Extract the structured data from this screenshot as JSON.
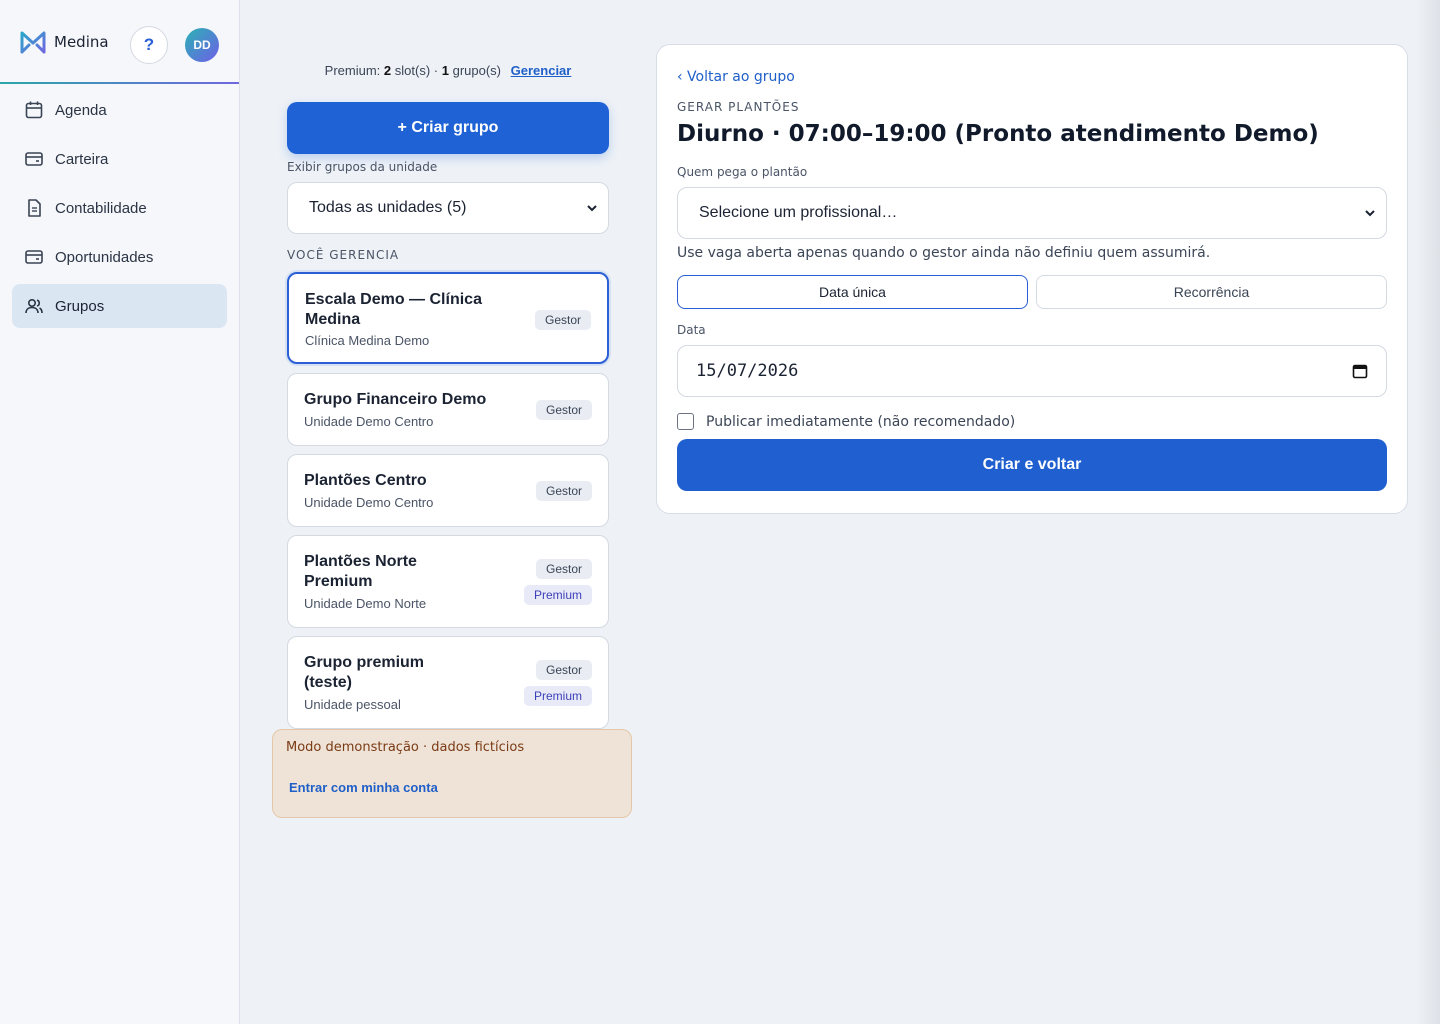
{
  "app": {
    "brand": "Medina",
    "help_label": "?",
    "avatar_initials": "DD"
  },
  "sidebar": {
    "items": [
      {
        "label": "Agenda",
        "icon": "calendar-icon",
        "active": false
      },
      {
        "label": "Carteira",
        "icon": "wallet-icon",
        "active": false
      },
      {
        "label": "Contabilidade",
        "icon": "document-icon",
        "active": false
      },
      {
        "label": "Oportunidades",
        "icon": "card-icon",
        "active": false
      },
      {
        "label": "Grupos",
        "icon": "users-icon",
        "active": true
      }
    ]
  },
  "groups_panel": {
    "premium_prefix": "Premium:",
    "slots_count": "2",
    "slots_label": "slot(s) ·",
    "groups_count": "1",
    "groups_label": "grupo(s)",
    "manage_link": "Gerenciar",
    "create_button": "+ Criar grupo",
    "unit_filter_label": "Exibir grupos da unidade",
    "unit_filter_value": "Todas as unidades (5)",
    "section_title": "VOCÊ GERENCIA",
    "groups": [
      {
        "title": "Escala Demo — Clínica Medina",
        "subtitle": "Clínica Medina Demo",
        "badges": [
          "Gestor"
        ]
      },
      {
        "title": "Grupo Financeiro Demo",
        "subtitle": "Unidade Demo Centro",
        "badges": [
          "Gestor"
        ]
      },
      {
        "title": "Plantões Centro",
        "subtitle": "Unidade Demo Centro",
        "badges": [
          "Gestor"
        ]
      },
      {
        "title": "Plantões Norte Premium",
        "subtitle": "Unidade Demo Norte",
        "badges": [
          "Gestor",
          "Premium"
        ]
      },
      {
        "title": "Grupo premium (teste)",
        "subtitle": "Unidade pessoal",
        "badges": [
          "Gestor",
          "Premium"
        ]
      }
    ],
    "demo_notice": "Modo demonstração · dados fictícios",
    "demo_link": "Entrar com minha conta"
  },
  "form": {
    "back_link": "‹ Voltar ao grupo",
    "eyebrow": "GERAR PLANTÕES",
    "title": "Diurno · 07:00–19:00 (Pronto atendimento Demo)",
    "who_label": "Quem pega o plantão",
    "who_value": "Selecione um profissional…",
    "hint": "Use vaga aberta apenas quando o gestor ainda não definiu quem assumirá.",
    "mode_single": "Data única",
    "mode_recurring": "Recorrência",
    "date_label": "Data",
    "date_value": "15/07/2026",
    "publish_label": "Publicar imediatamente (não recomendado)",
    "publish_checked": false,
    "submit": "Criar e voltar"
  },
  "colors": {
    "primary": "#1f62d6",
    "active_nav": "#dbe6f3",
    "demo_bg": "#efe3d7"
  }
}
